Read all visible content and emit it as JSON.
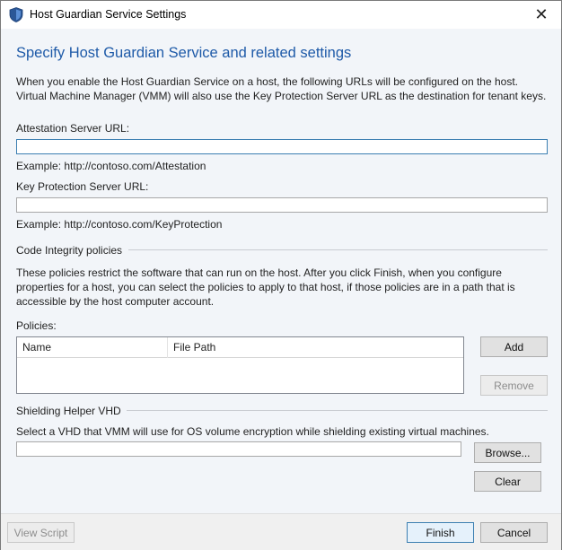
{
  "window": {
    "title": "Host Guardian Service Settings",
    "close_glyph": "✕"
  },
  "main": {
    "heading": "Specify Host Guardian Service and related settings",
    "description": "When you enable the Host Guardian Service on a host, the following URLs will be configured on the host. Virtual Machine Manager (VMM) will also use the Key Protection Server URL as the destination for tenant keys.",
    "attestation": {
      "label": "Attestation Server URL:",
      "value": "",
      "example": "Example: http://contoso.com/Attestation"
    },
    "key_protection": {
      "label": "Key Protection Server URL:",
      "value": "",
      "example": "Example: http://contoso.com/KeyProtection"
    }
  },
  "code_integrity": {
    "section_title": "Code Integrity policies",
    "description": "These policies restrict the software that can run on the host. After you click Finish, when you configure properties for a host, you can select the policies to apply to that host, if those policies are in a path that is accessible by the host computer account.",
    "policies_label": "Policies:",
    "columns": [
      "Name",
      "File Path"
    ],
    "rows": [],
    "add_label": "Add",
    "remove_label": "Remove"
  },
  "shielding": {
    "section_title": "Shielding Helper VHD",
    "description": "Select a VHD that VMM will use for OS volume encryption while shielding existing virtual machines.",
    "vhd_value": "",
    "browse_label": "Browse...",
    "clear_label": "Clear"
  },
  "footer": {
    "view_script_label": "View Script",
    "finish_label": "Finish",
    "cancel_label": "Cancel"
  },
  "colors": {
    "heading": "#1e5aa8",
    "focus_border": "#3c7fb1",
    "content_bg": "#f2f5f9"
  },
  "icons": {
    "title_icon": "shield-icon"
  }
}
